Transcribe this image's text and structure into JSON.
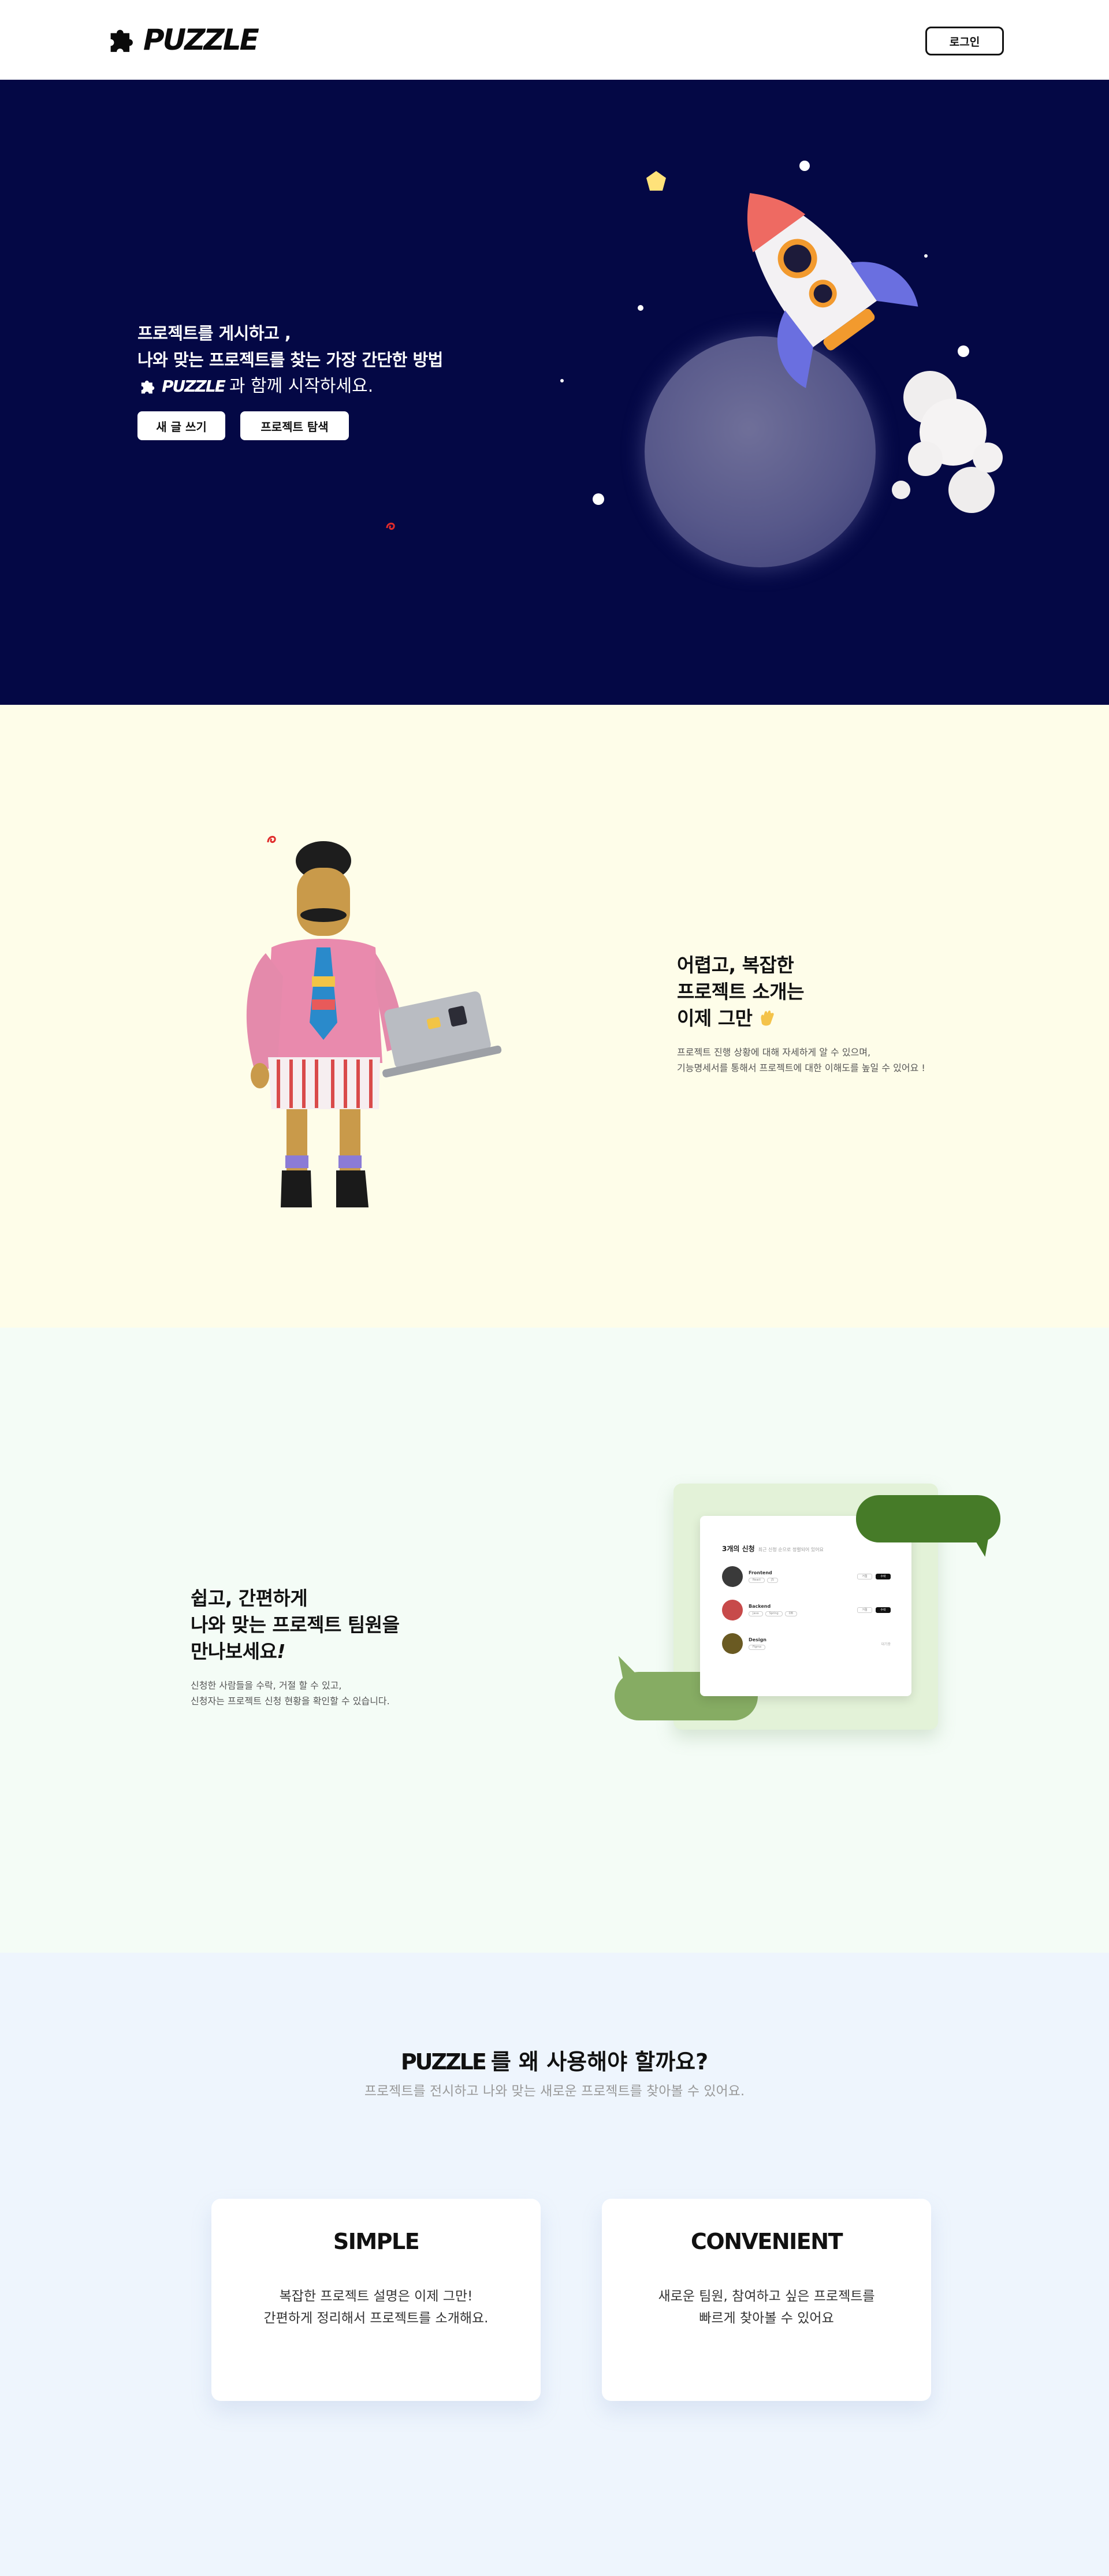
{
  "header": {
    "brand": "PUZZLE",
    "login_label": "로그인"
  },
  "hero": {
    "line1": "프로젝트를 게시하고 ,",
    "line2": "나와 맞는 프로젝트를 찾는 가장 간단한 방법",
    "brand": "PUZZLE",
    "line3_suffix": "과 함께 시작하세요.",
    "btn_write": "새 글 쓰기",
    "btn_explore": "프로젝트 탐색"
  },
  "section_intro": {
    "title1": "어렵고, 복잡한",
    "title2": "프로젝트 소개는",
    "title3": "이제 그만",
    "desc1": "프로젝트 진행 상황에 대해 자세하게 알 수 있으며,",
    "desc2": "기능명세서를 통해서 프로젝트에 대한 이해도를 높일 수 있어요 !"
  },
  "section_team": {
    "title1": "쉽고, 간편하게",
    "title2": "나와 맞는 프로젝트 팀원을",
    "title3": "만나보세요",
    "title3_mark": "!",
    "desc1": "신청한 사람들을 수락, 거절 할 수 있고,",
    "desc2": "신청자는 프로젝트 신청 현황을 확인할 수 있습니다.",
    "mock": {
      "title": "3개의 신청",
      "title_sub": "최근 신청 순으로 정렬되어 있어요",
      "rows": [
        {
          "name": "Frontend",
          "tags": [
            "React",
            "JS"
          ],
          "accept": "수락",
          "reject": "거절",
          "avatar_color": "#3a3a3a"
        },
        {
          "name": "Backend",
          "tags": [
            "Java",
            "Spring",
            "DB"
          ],
          "accept": "수락",
          "reject": "거절",
          "avatar_color": "#c74a4a"
        },
        {
          "name": "Design",
          "tags": [
            "Figma"
          ],
          "status": "대기중",
          "avatar_color": "#6a5a22"
        }
      ]
    }
  },
  "section_why": {
    "brand": "PUZZLE",
    "title_suffix": "를 왜 사용해야 할까요?",
    "subtitle": "프로젝트를 전시하고 나와 맞는 새로운 프로젝트를 찾아볼 수 있어요.",
    "cards": [
      {
        "title": "SIMPLE",
        "desc1": "복잡한 프로젝트 설명은 이제 그만!",
        "desc2": "간편하게 정리해서 프로젝트를 소개해요."
      },
      {
        "title": "CONVENIENT",
        "desc1": "새로운 팀원, 참여하고 싶은 프로젝트를",
        "desc2": "빠르게 찾아볼 수 있어요"
      }
    ]
  },
  "colors": {
    "hero_bg": "#040845",
    "intro_bg": "#fefde9",
    "team_bg": "#f4fcf6",
    "why_bg": "#eef5fd",
    "bubble_dark": "#467b28",
    "bubble_light": "#86ac63"
  },
  "icons": [
    "puzzle-piece-icon",
    "rocket-illustration",
    "character-illustration",
    "waving-hand-icon"
  ]
}
